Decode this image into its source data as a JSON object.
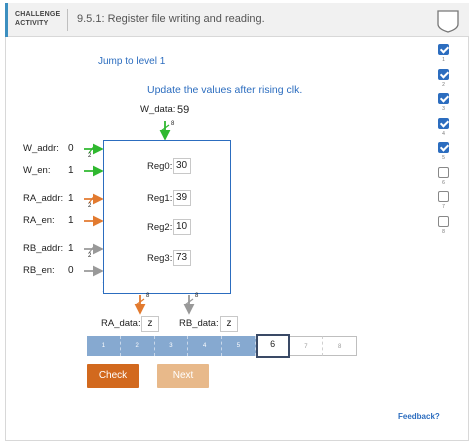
{
  "header": {
    "badge_line1": "CHALLENGE",
    "badge_line2": "ACTIVITY",
    "title": "9.5.1: Register file writing and reading."
  },
  "levels": [
    {
      "num": "1",
      "done": true
    },
    {
      "num": "2",
      "done": true
    },
    {
      "num": "3",
      "done": true
    },
    {
      "num": "4",
      "done": true
    },
    {
      "num": "5",
      "done": true
    },
    {
      "num": "6",
      "done": false
    },
    {
      "num": "7",
      "done": false
    },
    {
      "num": "8",
      "done": false
    }
  ],
  "jump_link": "Jump to level 1",
  "instruction": "Update the values after rising clk.",
  "inputs": {
    "w_data_label": "W_data:",
    "w_data_value": "59",
    "w_data_width": "8",
    "w_addr_label": "W_addr:",
    "w_addr_value": "0",
    "w_addr_width": "2",
    "w_en_label": "W_en:",
    "w_en_value": "1",
    "ra_addr_label": "RA_addr:",
    "ra_addr_value": "1",
    "ra_addr_width": "2",
    "ra_en_label": "RA_en:",
    "ra_en_value": "1",
    "rb_addr_label": "RB_addr:",
    "rb_addr_value": "1",
    "rb_addr_width": "2",
    "rb_en_label": "RB_en:",
    "rb_en_value": "0"
  },
  "registers": [
    {
      "label": "Reg0:",
      "value": "30"
    },
    {
      "label": "Reg1:",
      "value": "39"
    },
    {
      "label": "Reg2:",
      "value": "10"
    },
    {
      "label": "Reg3:",
      "value": "73"
    }
  ],
  "outputs": {
    "ra_data_label": "RA_data:",
    "ra_data_value": "z",
    "ra_data_width": "8",
    "rb_data_label": "RB_data:",
    "rb_data_value": "z",
    "rb_data_width": "8"
  },
  "progress": {
    "segments": [
      "1",
      "2",
      "3",
      "4",
      "5",
      "6",
      "7",
      "8"
    ],
    "completed": 5,
    "current": 6
  },
  "buttons": {
    "check": "Check",
    "next": "Next"
  },
  "feedback": "Feedback?",
  "colors": {
    "accent": "#2c6dbf",
    "write_wire": "#2fb82f",
    "read_a_wire": "#e27a2f",
    "read_b_wire": "#999999",
    "check_button": "#d2691e",
    "next_button": "#e8b98a"
  }
}
